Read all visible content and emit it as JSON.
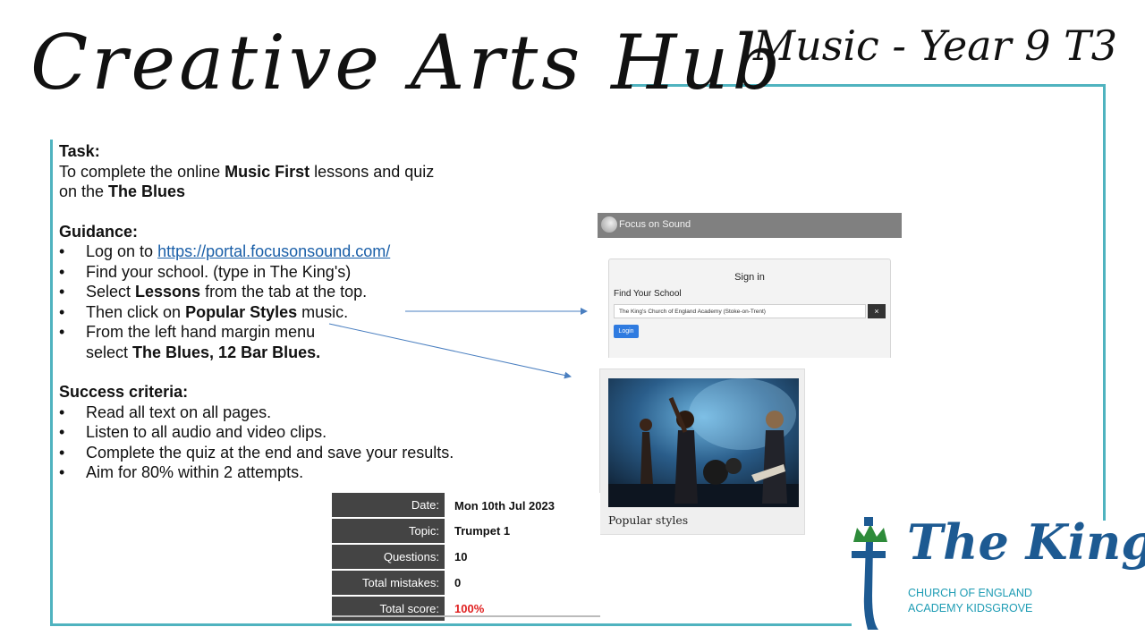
{
  "header": {
    "title": "Creative Arts Hub",
    "subtitle": "Music - Year 9 T3"
  },
  "task": {
    "heading": "Task:",
    "line1_pre": "To complete the online ",
    "line1_bold": "Music First",
    "line1_post": " lessons and quiz",
    "line2_pre": "on the ",
    "line2_bold": "The Blues"
  },
  "guidance": {
    "heading": "Guidance:",
    "item1_pre": "Log on to ",
    "item1_link": "https://portal.focusonsound.com/",
    "item2": "Find your school. (type in The King's)",
    "item3_pre": "Select ",
    "item3_bold": "Lessons",
    "item3_post": " from the tab at the top.",
    "item4_pre": "Then click on ",
    "item4_bold": "Popular Styles",
    "item4_post": " music.",
    "item5_line1": "From the left hand margin menu",
    "item5_line2_pre": "select ",
    "item5_line2_bold": "The Blues, 12 Bar Blues."
  },
  "success": {
    "heading": "Success criteria:",
    "items": [
      "Read all text on all pages.",
      "Listen to all audio and video clips.",
      "Complete the quiz at the end and save your results.",
      "Aim for 80% within 2 attempts."
    ]
  },
  "signin_screenshot": {
    "logo_text": "Focus on Sound",
    "signin_title": "Sign in",
    "find_label": "Find Your School",
    "school_value": "The King's Church of England Academy (Stoke-on-Trent)",
    "clear_label": "×",
    "login_label": "Login"
  },
  "popular_card": {
    "caption": "Popular styles"
  },
  "results": {
    "rows": [
      {
        "label": "Date:",
        "value": "Mon 10th Jul 2023"
      },
      {
        "label": "Topic:",
        "value": "Trumpet 1"
      },
      {
        "label": "Questions:",
        "value": "10"
      },
      {
        "label": "Total mistakes:",
        "value": "0"
      },
      {
        "label": "Total score:",
        "value": "100%"
      }
    ],
    "score_color": "#e02020"
  },
  "logo": {
    "name": "The King's",
    "line1": "CHURCH OF ENGLAND",
    "line2": "ACADEMY KIDSGROVE"
  },
  "colors": {
    "frame": "#4fb3bf",
    "link": "#1a5fa8",
    "logo_blue": "#1d5a92",
    "logo_teal": "#1e9cb4",
    "logo_crown": "#2e8b3a"
  }
}
